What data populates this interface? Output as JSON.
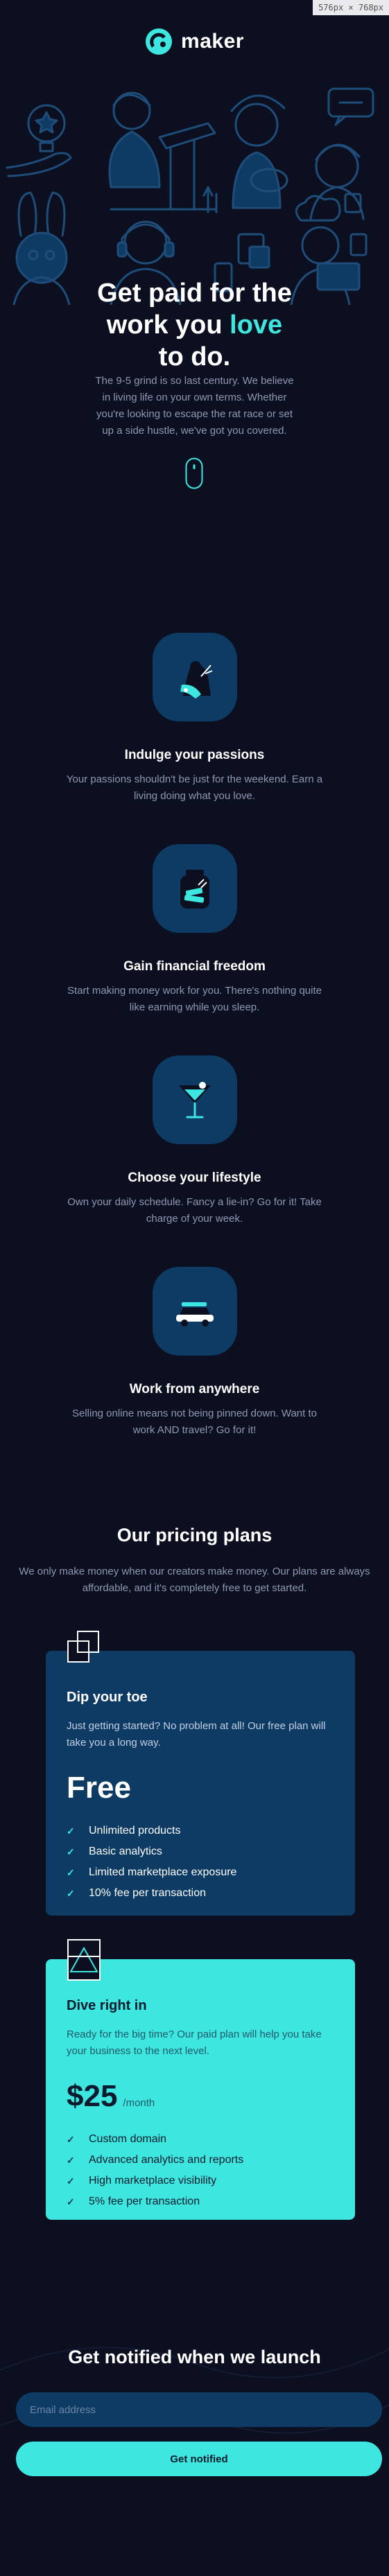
{
  "viewport_badge": "576px × 768px",
  "brand": {
    "name": "maker"
  },
  "hero": {
    "title_line1": "Get paid for the",
    "title_line2_prefix": "work you ",
    "title_line2_accent": "love",
    "title_line3": "to do.",
    "description": "The 9-5 grind is so last century. We believe in living life on your own terms. Whether you're looking to escape the rat race or set up a side hustle, we've got you covered."
  },
  "features": [
    {
      "icon": "passion-icon",
      "title": "Indulge your passions",
      "description": "Your passions shouldn't be just for the weekend. Earn a living doing what you love."
    },
    {
      "icon": "money-jar-icon",
      "title": "Gain financial freedom",
      "description": "Start making money work for you. There's nothing quite like earning while you sleep."
    },
    {
      "icon": "cocktail-icon",
      "title": "Choose your lifestyle",
      "description": "Own your daily schedule. Fancy a lie-in? Go for it! Take charge of your week."
    },
    {
      "icon": "car-icon",
      "title": "Work from anywhere",
      "description": "Selling online means not being pinned down. Want to work AND travel? Go for it!"
    }
  ],
  "pricing": {
    "title": "Our pricing plans",
    "description": "We only make money when our creators make money. Our plans are always affordable, and it's completely free to get started.",
    "plans": [
      {
        "icon": "overlapping-squares-icon",
        "name": "Dip your toe",
        "description": "Just getting started? No problem at all! Our free plan will take you a long way.",
        "price": "Free",
        "price_unit": "",
        "features": [
          "Unlimited products",
          "Basic analytics",
          "Limited marketplace exposure",
          "10% fee per transaction"
        ]
      },
      {
        "icon": "triangle-in-square-icon",
        "name": "Dive right in",
        "description": "Ready for the big time? Our paid plan will help you take your business to the next level.",
        "price": "$25",
        "price_unit": "/month",
        "features": [
          "Custom domain",
          "Advanced analytics and reports",
          "High marketplace visibility",
          "5% fee per transaction"
        ]
      }
    ]
  },
  "notify": {
    "title": "Get notified when we launch",
    "email_placeholder": "Email address",
    "button_label": "Get notified"
  },
  "colors": {
    "background": "#0b0f1f",
    "accent": "#3ee6e0",
    "card": "#0d3b63",
    "muted_text": "#8f98b4"
  }
}
